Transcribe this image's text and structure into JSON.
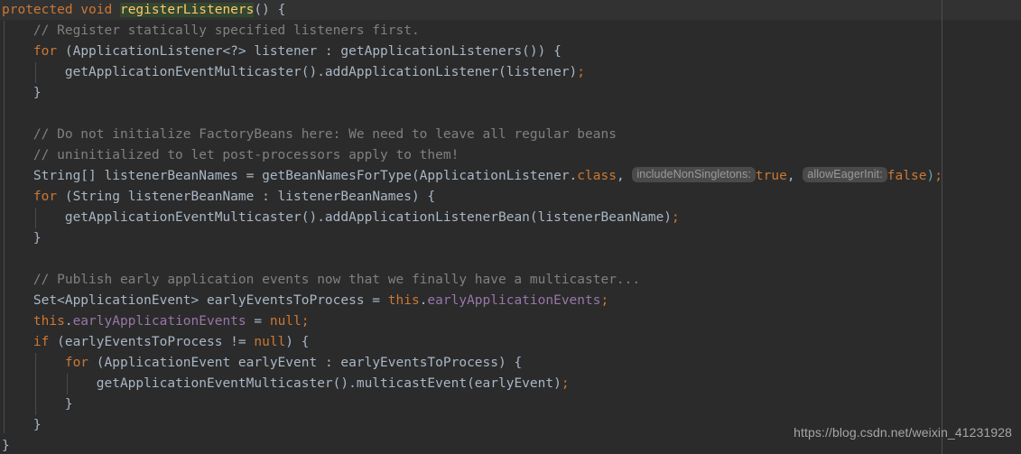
{
  "editor": {
    "theme": "Darcula",
    "background_color": "#2b2b2b",
    "caret_line_color": "#323232",
    "margin_guide_x": 1043,
    "colors": {
      "keyword": "#cc7832",
      "plain": "#a9b7c6",
      "method_declaration": "#ffc66d",
      "comment": "#808080",
      "field": "#9876aa",
      "paren": "#6a9fb5",
      "hint_background": "#4a4a4a",
      "hint_text": "#9a9a9a",
      "caret_identifier_highlight": "#32472f",
      "indent_guide": "#4b4b4b",
      "watermark": "#a6a6a6"
    }
  },
  "watermark": {
    "text": "https://blog.csdn.net/weixin_41231928"
  },
  "code": {
    "language": "java",
    "method_name": "registerListeners",
    "lines": [
      {
        "n": 1,
        "indent": 0,
        "text": "protected void registerListeners() {"
      },
      {
        "n": 2,
        "indent": 1,
        "text": "// Register statically specified listeners first."
      },
      {
        "n": 3,
        "indent": 1,
        "text": "for (ApplicationListener<?> listener : getApplicationListeners()) {"
      },
      {
        "n": 4,
        "indent": 2,
        "text": "getApplicationEventMulticaster().addApplicationListener(listener);"
      },
      {
        "n": 5,
        "indent": 1,
        "text": "}"
      },
      {
        "n": 6,
        "indent": 0,
        "text": ""
      },
      {
        "n": 7,
        "indent": 1,
        "text": "// Do not initialize FactoryBeans here: We need to leave all regular beans"
      },
      {
        "n": 8,
        "indent": 1,
        "text": "// uninitialized to let post-processors apply to them!"
      },
      {
        "n": 9,
        "indent": 1,
        "text": "String[] listenerBeanNames = getBeanNamesForType(ApplicationListener.class, true, false);"
      },
      {
        "n": 10,
        "indent": 1,
        "text": "for (String listenerBeanName : listenerBeanNames) {"
      },
      {
        "n": 11,
        "indent": 2,
        "text": "getApplicationEventMulticaster().addApplicationListenerBean(listenerBeanName);"
      },
      {
        "n": 12,
        "indent": 1,
        "text": "}"
      },
      {
        "n": 13,
        "indent": 0,
        "text": ""
      },
      {
        "n": 14,
        "indent": 1,
        "text": "// Publish early application events now that we finally have a multicaster..."
      },
      {
        "n": 15,
        "indent": 1,
        "text": "Set<ApplicationEvent> earlyEventsToProcess = this.earlyApplicationEvents;"
      },
      {
        "n": 16,
        "indent": 1,
        "text": "this.earlyApplicationEvents = null;"
      },
      {
        "n": 17,
        "indent": 1,
        "text": "if (earlyEventsToProcess != null) {"
      },
      {
        "n": 18,
        "indent": 2,
        "text": "for (ApplicationEvent earlyEvent : earlyEventsToProcess) {"
      },
      {
        "n": 19,
        "indent": 3,
        "text": "getApplicationEventMulticaster().multicastEvent(earlyEvent);"
      },
      {
        "n": 20,
        "indent": 2,
        "text": "}"
      },
      {
        "n": 21,
        "indent": 1,
        "text": "}"
      },
      {
        "n": 22,
        "indent": 0,
        "text": "}"
      }
    ],
    "parameter_hints": [
      {
        "label": "includeNonSingletons:",
        "value": "true",
        "line": 9
      },
      {
        "label": "allowEagerInit:",
        "value": "false",
        "line": 9
      }
    ],
    "tokens": {
      "l1": {
        "a": "protected",
        "b": " void ",
        "c": "registerListeners",
        "d": "() {"
      },
      "l2": {
        "a": "// Register statically specified listeners first."
      },
      "l3": {
        "a": "for",
        "b": " (ApplicationListener<?> listener : getApplicationListeners())",
        "c": " {"
      },
      "l4": {
        "a": "getApplicationEventMulticaster().addApplicationListener(listener)",
        "b": ";"
      },
      "l5": {
        "a": "}"
      },
      "l7": {
        "a": "// Do not initialize FactoryBeans here: We need to leave all regular beans"
      },
      "l8": {
        "a": "// uninitialized to let post-processors apply to them!"
      },
      "l9": {
        "a": "String[] listenerBeanNames = getBeanNamesForType(ApplicationListener.",
        "b": "class",
        "c": ", ",
        "d": "includeNonSingletons:",
        "e": "true",
        "f": ", ",
        "g": "allowEagerInit:",
        "h": "false",
        "i": ")",
        "j": ";"
      },
      "l10": {
        "a": "for",
        "b": " (String listenerBeanName : listenerBeanNames)",
        "c": " {"
      },
      "l11": {
        "a": "getApplicationEventMulticaster().addApplicationListenerBean(listenerBeanName)",
        "b": ";"
      },
      "l12": {
        "a": "}"
      },
      "l14": {
        "a": "// Publish early application events now that we finally have a multicaster..."
      },
      "l15": {
        "a": "Set<ApplicationEvent> earlyEventsToProcess = ",
        "b": "this",
        "c": ".",
        "d": "earlyApplicationEvents",
        "e": ";"
      },
      "l16": {
        "a": "this",
        "b": ".",
        "c": "earlyApplicationEvents",
        "d": " = ",
        "e": "null",
        "f": ";"
      },
      "l17": {
        "a": "if",
        "b": " (earlyEventsToProcess != ",
        "c": "null",
        "d": ") {"
      },
      "l18": {
        "a": "for",
        "b": " (ApplicationEvent earlyEvent : earlyEventsToProcess)",
        "c": " {"
      },
      "l19": {
        "a": "getApplicationEventMulticaster().multicastEvent(earlyEvent)",
        "b": ";"
      },
      "l20": {
        "a": "}"
      },
      "l21": {
        "a": "}"
      },
      "l22": {
        "a": "}"
      }
    }
  }
}
